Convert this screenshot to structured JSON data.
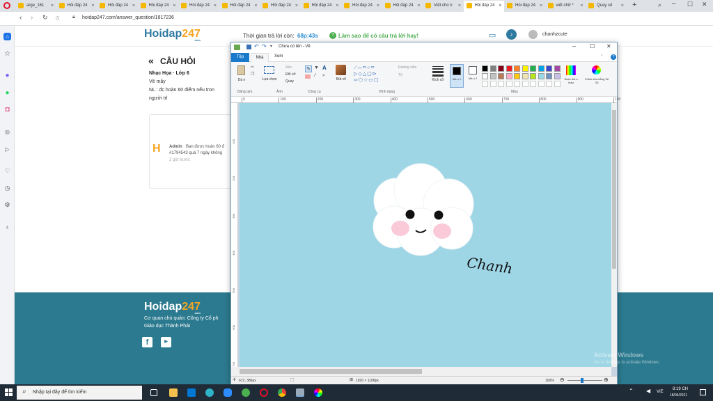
{
  "browser": {
    "tabs": [
      {
        "label": "arge_161"
      },
      {
        "label": "Hỏi đáp 24"
      },
      {
        "label": "Hỏi đáp 24"
      },
      {
        "label": "Hỏi đáp 24"
      },
      {
        "label": "Hỏi đáp 24"
      },
      {
        "label": "Hỏi đáp 24"
      },
      {
        "label": "Hỏi đáp 24"
      },
      {
        "label": "Hỏi đáp 24"
      },
      {
        "label": "Hỏi đáp 24"
      },
      {
        "label": "Hỏi đáp 24"
      },
      {
        "label": "Viết cho n"
      },
      {
        "label": "Hỏi đáp 24"
      },
      {
        "label": "Hỏi đáp 24"
      },
      {
        "label": "viết chữ *"
      },
      {
        "label": "Quay số"
      }
    ],
    "url": "hoidap247.com/answer_question/1817236"
  },
  "site": {
    "logo_main": "Hoidap",
    "logo_num": "247",
    "logo_com": ".com",
    "timer_label": "Thời gian trả lời còn:",
    "timer_value": "68p:43s",
    "help_link": "Làm sao để có câu trả lời hay!",
    "username": "chanhzcute",
    "section_title": "CÂU HỎI",
    "subject": "Nhạc Họa · Lớp 6",
    "question_line1": "Vẽ mây",
    "question_line2": "NL : đc hoàn 60 điểm nếu tron",
    "question_line3": "người trl",
    "comment_author": "Admin",
    "comment_text1": "Bạn được hoàn 60 đ",
    "comment_text2": "#1794543 quá 7 ngày không",
    "comment_time": "2 giờ trước",
    "footer_line1": "Cơ quan chủ quản: Công ty Cổ ph",
    "footer_line2": "Giáo dục Thành Phát"
  },
  "paint": {
    "title": "Chưa có tên - Vẽ",
    "tabs": {
      "file": "Tệp",
      "home": "Nhà",
      "view": "Xem"
    },
    "groups": {
      "clipboard": "Bảng tạm",
      "image": "Ảnh",
      "tools": "Công cụ",
      "shapes": "Hình dạng",
      "colors": "Màu"
    },
    "buttons": {
      "paste": "Dá n",
      "select": "Lựa chọn",
      "cut": "Xén",
      "resize": "Đổi cỡ",
      "rotate": "Quay",
      "brushes": "Bút vẽ",
      "outline": "Đường viền",
      "fill": "Tô",
      "size": "Kích cỡ",
      "color1": "Mà u 1",
      "color2": "Mà u 2",
      "edit_colors": "Soạn thả o màu",
      "paint3d": "Chỉnh sửa bằng Vẽ 3D"
    },
    "ruler_ticks": [
      "0",
      "100",
      "200",
      "300",
      "400",
      "500",
      "600",
      "700",
      "800",
      "900",
      "100"
    ],
    "ruler_side_ticks": [
      "100",
      "200",
      "300",
      "400",
      "500",
      "600",
      "700"
    ],
    "canvas_color": "#9ed6e6",
    "handwriting": "Chanh",
    "status": {
      "cursor": "672, 386px",
      "canvas_size": "1920 × 1108px",
      "zoom": "100%"
    },
    "palette": [
      "#000000",
      "#7f7f7f",
      "#880015",
      "#ed1c24",
      "#ff7f27",
      "#fff200",
      "#22b14c",
      "#00a2e8",
      "#3f48cc",
      "#a349a4",
      "#ffffff",
      "#c3c3c3",
      "#b97a57",
      "#ffaec9",
      "#ffc90e",
      "#efe4b0",
      "#b5e61d",
      "#99d9ea",
      "#7092be",
      "#c8bfe7"
    ]
  },
  "watermark": {
    "line1": "Activate Windows",
    "line2": "Go to Settings to activate Windows."
  },
  "taskbar": {
    "search_placeholder": "Nhập tại đây để tìm kiếm",
    "time": "8:19 CH",
    "date": "18/04/2021",
    "lang": "VIE"
  }
}
